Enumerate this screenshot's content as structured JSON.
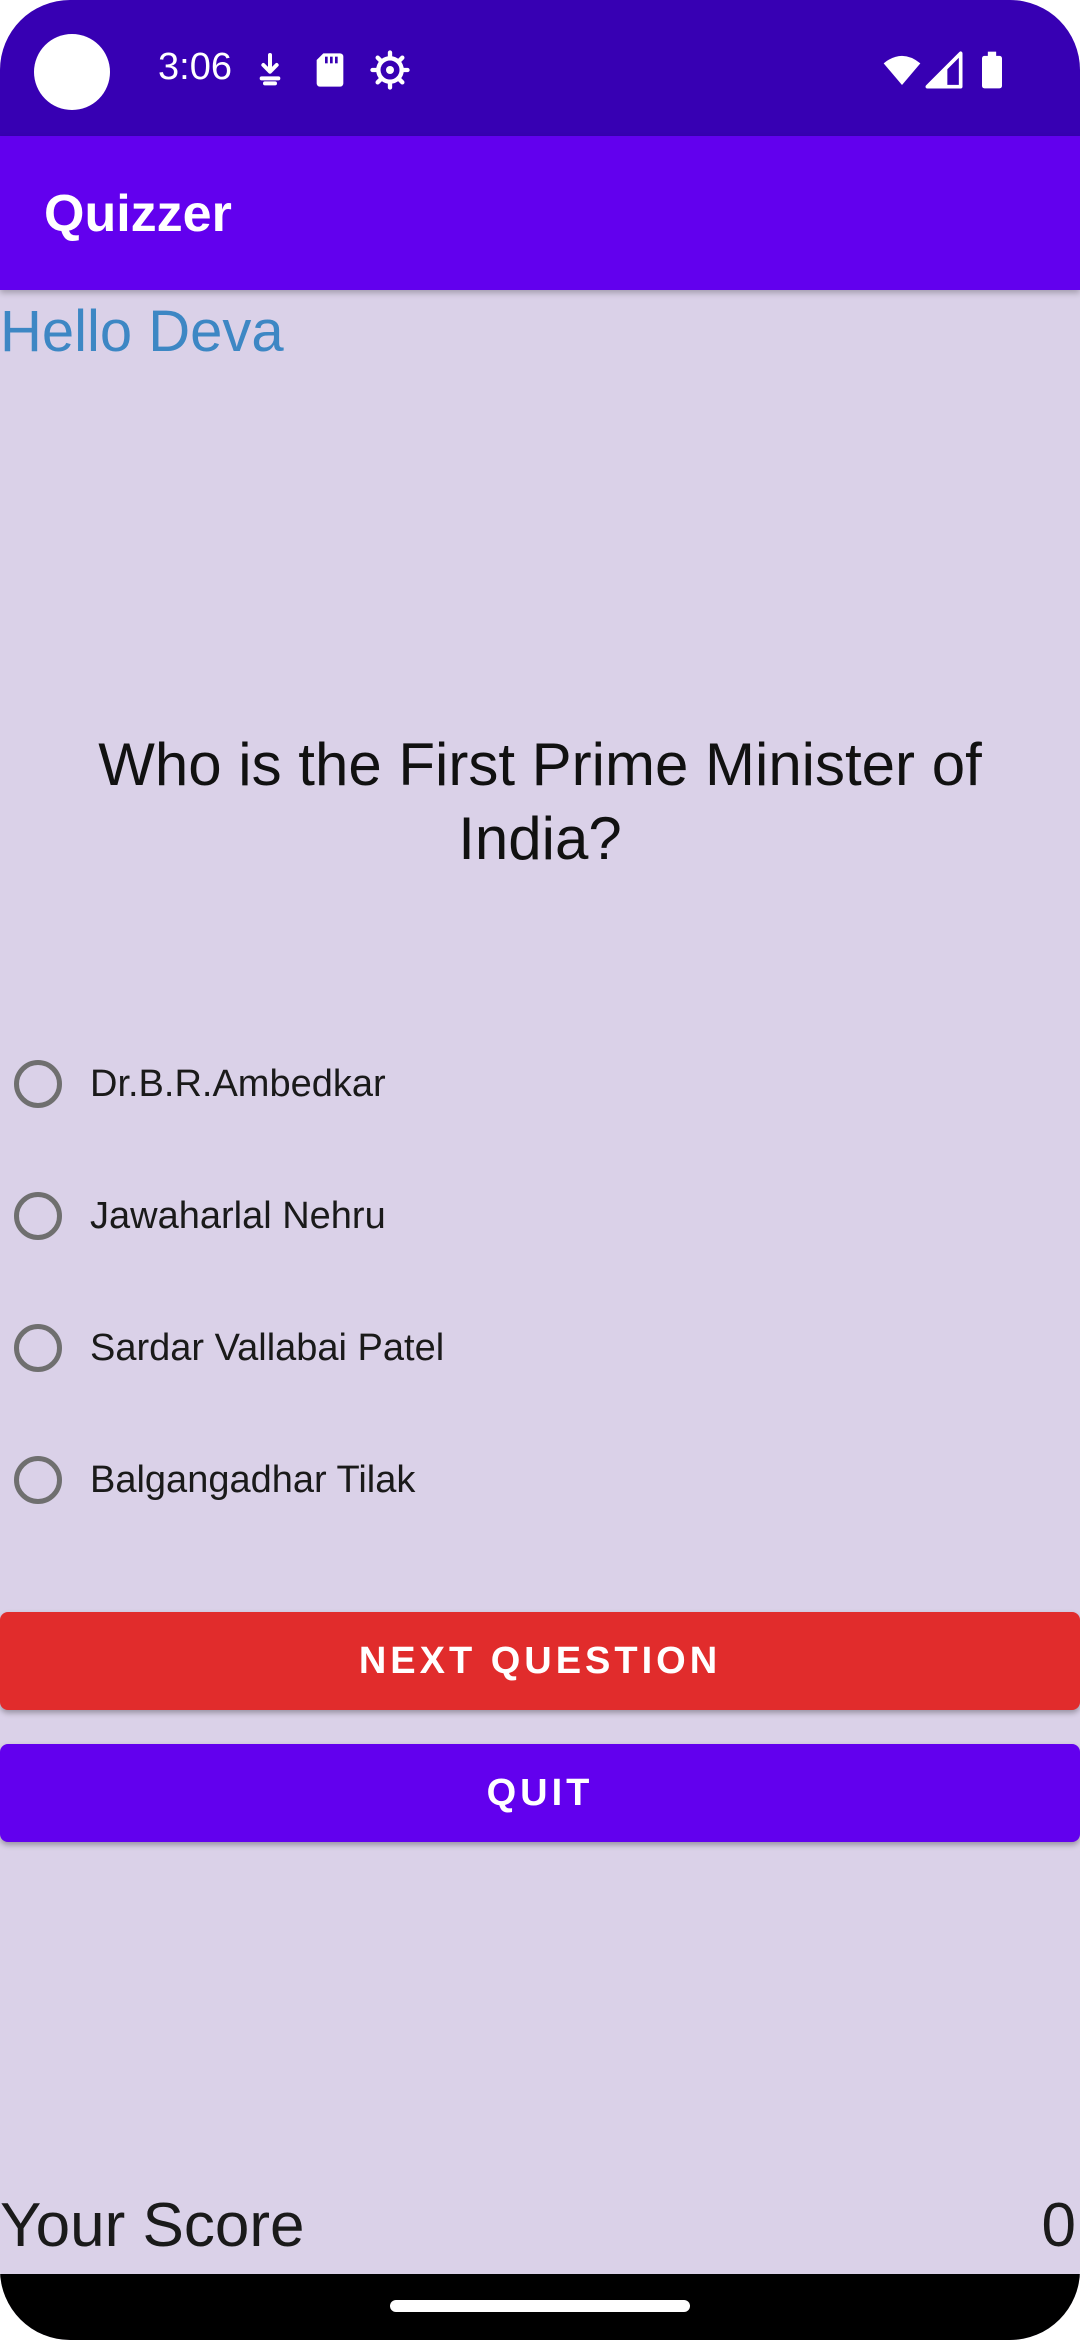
{
  "status_bar": {
    "time": "3:06",
    "icons_left": [
      "download-icon",
      "sd-card-icon",
      "settings-gear-icon"
    ],
    "icons_right": [
      "wifi-icon",
      "signal-icon",
      "battery-icon"
    ]
  },
  "app_bar": {
    "title": "Quizzer"
  },
  "greeting": "Hello Deva",
  "question": "Who is the First Prime Minister of India?",
  "options": [
    {
      "label": "Dr.B.R.Ambedkar"
    },
    {
      "label": "Jawaharlal Nehru"
    },
    {
      "label": "Sardar Vallabai Patel"
    },
    {
      "label": "Balgangadhar Tilak"
    }
  ],
  "buttons": {
    "next_label": "NEXT QUESTION",
    "quit_label": "QUIT"
  },
  "score": {
    "label": "Your Score",
    "value": "0"
  },
  "colors": {
    "status_bar": "#3700b3",
    "app_bar": "#6200ee",
    "background": "#dad1e8",
    "greeting": "#3d87c4",
    "next_button": "#e12c2c",
    "quit_button": "#6200ee"
  }
}
